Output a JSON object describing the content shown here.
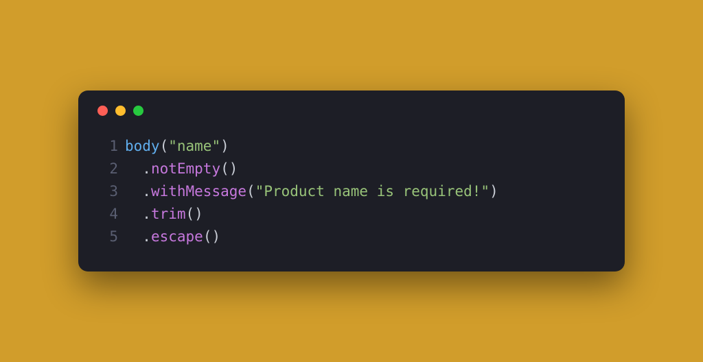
{
  "traffic_lights": {
    "red": "close",
    "yellow": "minimize",
    "green": "zoom"
  },
  "code": {
    "lines": [
      {
        "no": "1",
        "indent": "",
        "tokens": [
          {
            "t": "body",
            "c": "tok-fn"
          },
          {
            "t": "(",
            "c": "tok-punc"
          },
          {
            "t": "\"name\"",
            "c": "tok-str"
          },
          {
            "t": ")",
            "c": "tok-punc"
          }
        ]
      },
      {
        "no": "2",
        "indent": "  ",
        "tokens": [
          {
            "t": ".",
            "c": "tok-punc"
          },
          {
            "t": "notEmpty",
            "c": "tok-method"
          },
          {
            "t": "()",
            "c": "tok-punc"
          }
        ]
      },
      {
        "no": "3",
        "indent": "  ",
        "tokens": [
          {
            "t": ".",
            "c": "tok-punc"
          },
          {
            "t": "withMessage",
            "c": "tok-method"
          },
          {
            "t": "(",
            "c": "tok-punc"
          },
          {
            "t": "\"Product name is required!\"",
            "c": "tok-str"
          },
          {
            "t": ")",
            "c": "tok-punc"
          }
        ]
      },
      {
        "no": "4",
        "indent": "  ",
        "tokens": [
          {
            "t": ".",
            "c": "tok-punc"
          },
          {
            "t": "trim",
            "c": "tok-method"
          },
          {
            "t": "()",
            "c": "tok-punc"
          }
        ]
      },
      {
        "no": "5",
        "indent": "  ",
        "tokens": [
          {
            "t": ".",
            "c": "tok-punc"
          },
          {
            "t": "escape",
            "c": "tok-method"
          },
          {
            "t": "()",
            "c": "tok-punc"
          }
        ]
      }
    ]
  }
}
